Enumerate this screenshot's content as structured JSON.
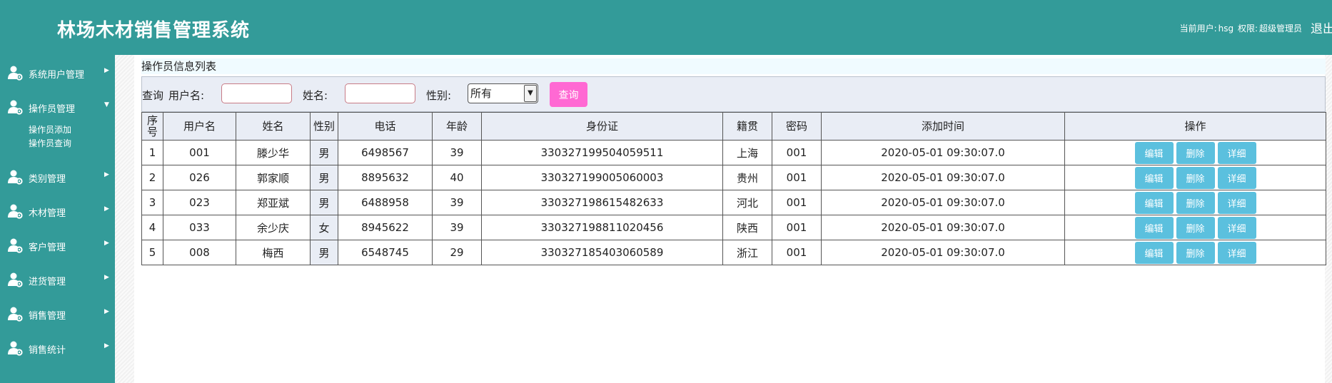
{
  "header": {
    "title": "林场木材销售管理系统",
    "current_user_label": "当前用户:",
    "current_user": "hsg",
    "role_label": "权限:",
    "role": "超级管理员",
    "logout": "退出"
  },
  "sidebar": {
    "items": [
      {
        "label": "系统用户管理",
        "icon": "user-gear-icon",
        "expanded": false
      },
      {
        "label": "操作员管理",
        "icon": "user-gear-icon",
        "expanded": true,
        "children": [
          {
            "label": "操作员添加"
          },
          {
            "label": "操作员查询"
          }
        ]
      },
      {
        "label": "类别管理",
        "icon": "user-gear-icon",
        "expanded": false
      },
      {
        "label": "木材管理",
        "icon": "user-gear-icon",
        "expanded": false
      },
      {
        "label": "客户管理",
        "icon": "user-gear-icon",
        "expanded": false
      },
      {
        "label": "进货管理",
        "icon": "user-gear-icon",
        "expanded": false
      },
      {
        "label": "销售管理",
        "icon": "user-gear-icon",
        "expanded": false
      },
      {
        "label": "销售统计",
        "icon": "user-gear-icon",
        "expanded": false
      }
    ]
  },
  "main": {
    "list_title": "操作员信息列表",
    "query": {
      "prefix": "查询",
      "username_label": "用户名:",
      "username_value": "",
      "name_label": "姓名:",
      "name_value": "",
      "sex_label": "性别:",
      "sex_selected": "所有",
      "button": "查询"
    },
    "table": {
      "headers": [
        "序号",
        "用户名",
        "姓名",
        "性别",
        "电话",
        "年龄",
        "身份证",
        "籍贯",
        "密码",
        "添加时间",
        "操作"
      ],
      "rows": [
        [
          "1",
          "001",
          "滕少华",
          "男",
          "6498567",
          "39",
          "330327199504059511",
          "上海",
          "001",
          "2020-05-01 09:30:07.0"
        ],
        [
          "2",
          "026",
          "郭家顺",
          "男",
          "8895632",
          "40",
          "330327199005060003",
          "贵州",
          "001",
          "2020-05-01 09:30:07.0"
        ],
        [
          "3",
          "023",
          "郑亚斌",
          "男",
          "6488958",
          "39",
          "330327198615482633",
          "河北",
          "001",
          "2020-05-01 09:30:07.0"
        ],
        [
          "4",
          "033",
          "余少庆",
          "女",
          "8945622",
          "39",
          "330327198811020456",
          "陕西",
          "001",
          "2020-05-01 09:30:07.0"
        ],
        [
          "5",
          "008",
          "梅西",
          "男",
          "6548745",
          "29",
          "330327185403060589",
          "浙江",
          "001",
          "2020-05-01 09:30:07.0"
        ]
      ],
      "actions": [
        "编辑",
        "删除",
        "详细"
      ]
    }
  },
  "colors": {
    "brand": "#339b99",
    "query_button": "#ff69d3",
    "action_button": "#5bc0de",
    "header_row": "#e9edf5"
  }
}
